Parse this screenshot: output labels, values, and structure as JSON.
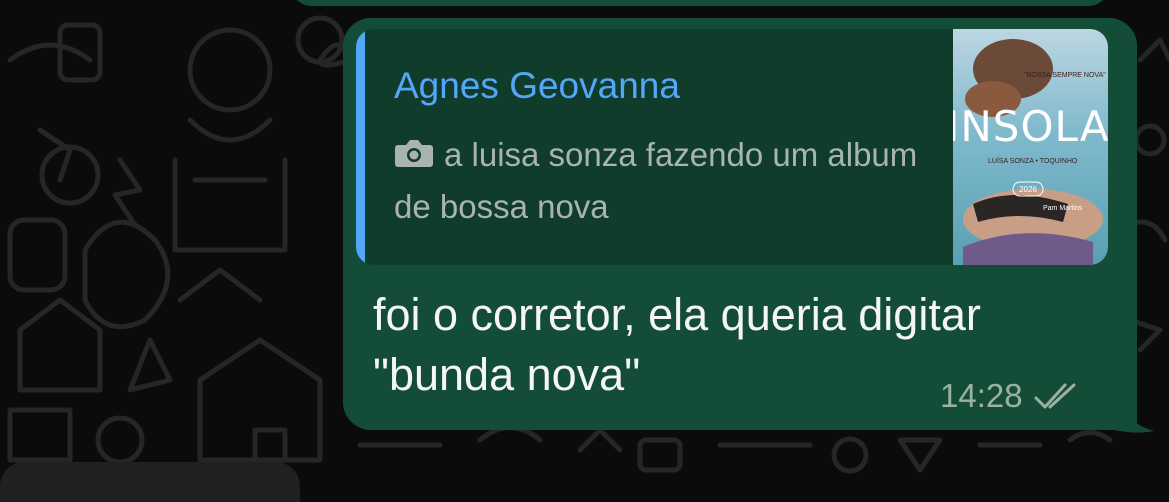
{
  "colors": {
    "bubble_outgoing": "#144d37",
    "quote_background": "#103d2b",
    "quote_accent": "#53a6f8",
    "chat_background": "#0b0b0b",
    "message_text": "#f4f5f4",
    "timestamp": "#9cb0a6"
  },
  "quoted_message": {
    "author": "Agnes Geovanna",
    "media_icon": "camera-icon",
    "text": "a luisa sonza fazendo um album de bossa nova",
    "thumbnail": {
      "title": "INSOLAÇ",
      "tagline": "\"BOSSA SEMPRE NOVA\"",
      "artists": "LUÍSA SONZA • TOQUINHO",
      "year": "2026",
      "credit": "Pam Martins"
    }
  },
  "message": {
    "text": "foi o corretor, ela queria digitar \"bunda nova\"",
    "time": "14:28",
    "status_icon": "double-check-read-icon"
  }
}
